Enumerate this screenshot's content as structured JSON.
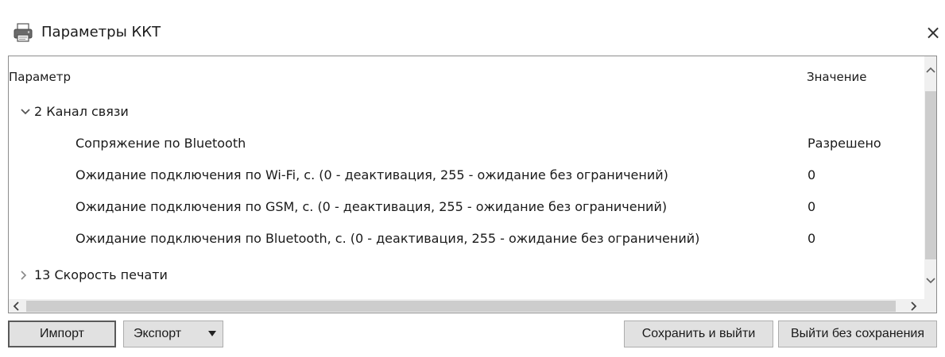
{
  "window": {
    "title": "Параметры ККТ",
    "icon": "printer-icon",
    "close_label": "×"
  },
  "grid": {
    "columns": {
      "param": "Параметр",
      "value": "Значение"
    },
    "rows": [
      {
        "kind": "group",
        "expanded": true,
        "name": "2 Канал связи",
        "value": ""
      },
      {
        "kind": "child",
        "name": "Сопряжение по Bluetooth",
        "value": "Разрешено"
      },
      {
        "kind": "child",
        "name": "Ожидание подключения по Wi-Fi, с. (0 - деактивация, 255 - ожидание без ограничений)",
        "value": "0"
      },
      {
        "kind": "child",
        "name": "Ожидание подключения по GSM, с. (0 - деактивация, 255 - ожидание без ограничений)",
        "value": "0"
      },
      {
        "kind": "child",
        "name": "Ожидание подключения по Bluetooth, с. (0 - деактивация, 255 - ожидание без ограничений)",
        "value": "0"
      },
      {
        "kind": "group",
        "expanded": false,
        "name": "13 Скорость печати",
        "value": ""
      }
    ]
  },
  "buttons": {
    "import": "Импорт",
    "export": "Экспорт",
    "save_exit": "Сохранить и выйти",
    "exit_no_save": "Выйти без сохранения"
  },
  "colors": {
    "border": "#8c8c8c",
    "button_bg": "#e1e1e1",
    "scroll_track": "#f0f0f0",
    "scroll_thumb": "#cdcdcd"
  }
}
